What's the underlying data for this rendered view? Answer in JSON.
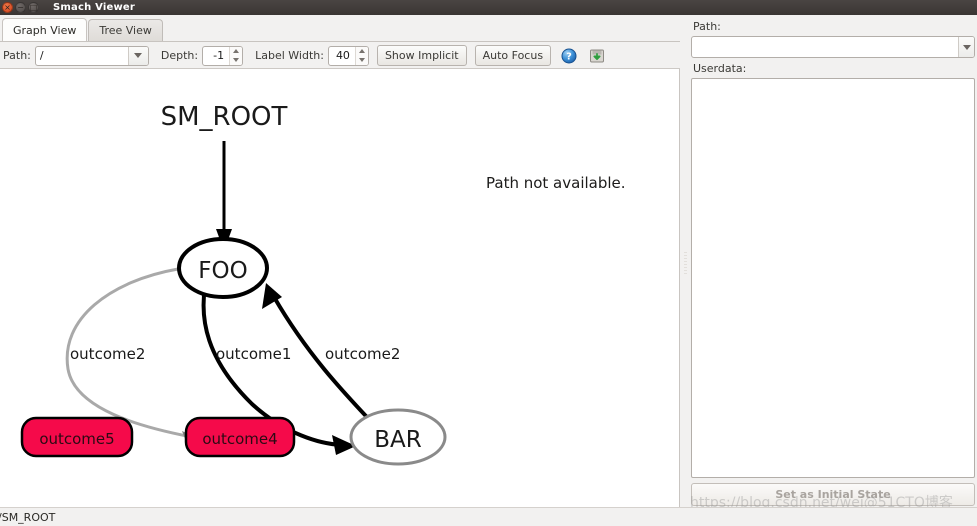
{
  "window": {
    "title": "Smach Viewer",
    "buttons": {
      "close": "close-button",
      "minimize": "minimize-button",
      "maximize": "maximize-button"
    }
  },
  "tabs": [
    {
      "label": "Graph View",
      "active": true
    },
    {
      "label": "Tree View",
      "active": false
    }
  ],
  "toolbar": {
    "path_label": "Path:",
    "path_value": "/",
    "depth_label": "Depth:",
    "depth_value": "-1",
    "label_width_label": "Label Width:",
    "label_width_value": "40",
    "show_implicit": "Show Implicit",
    "auto_focus": "Auto Focus",
    "help_icon": "help-icon",
    "save_icon": "save-icon"
  },
  "graph": {
    "title": "SM_ROOT",
    "note": "Path not available.",
    "nodes": [
      {
        "id": "FOO",
        "label": "FOO",
        "shape": "ellipse",
        "stroke": "#000000",
        "active": true
      },
      {
        "id": "BAR",
        "label": "BAR",
        "shape": "ellipse",
        "stroke": "#8a8a8a",
        "active": false
      },
      {
        "id": "outcome5",
        "label": "outcome5",
        "shape": "rounded-box",
        "fill": "#f50a4a",
        "stroke": "#000000"
      },
      {
        "id": "outcome4",
        "label": "outcome4",
        "shape": "rounded-box",
        "fill": "#f50a4a",
        "stroke": "#000000"
      }
    ],
    "edges": [
      {
        "from": "SM_ROOT",
        "to": "FOO",
        "label": "",
        "color": "#000000"
      },
      {
        "from": "FOO",
        "to": "BAR",
        "label": "outcome1",
        "color": "#000000"
      },
      {
        "from": "BAR",
        "to": "FOO",
        "label": "outcome2",
        "color": "#000000"
      },
      {
        "from": "FOO",
        "to": "outcome4",
        "label": "outcome2",
        "color": "#a9a9a9"
      }
    ],
    "edge_labels": {
      "left": "outcome2",
      "middle": "outcome1",
      "right": "outcome2"
    }
  },
  "rightpanel": {
    "path_label": "Path:",
    "path_value": "",
    "userdata_label": "Userdata:",
    "userdata_value": "",
    "set_initial_state": "Set as Initial State"
  },
  "statusbar": {
    "text": "/SM_ROOT"
  },
  "watermark": {
    "text": "https://blog.csdn.net/wei@51CTO博客"
  },
  "colors": {
    "outcome_fill": "#f50a4a",
    "active_node_stroke": "#000000",
    "inactive_node_stroke": "#8a8a8a",
    "inactive_edge": "#a9a9a9",
    "canvas_bg": "#ffffff",
    "chrome_bg": "#f2f1f0"
  }
}
